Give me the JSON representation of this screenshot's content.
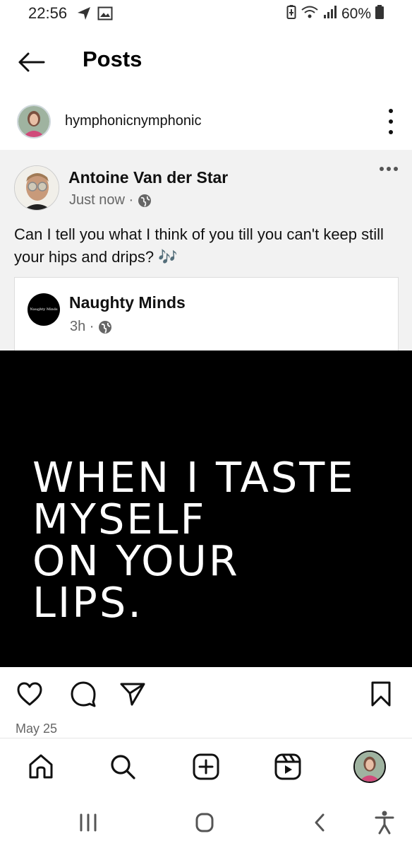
{
  "status": {
    "time": "22:56",
    "battery": "60%",
    "icons": [
      "navigation-icon",
      "gallery-icon",
      "battery-saver-icon",
      "wifi-icon",
      "signal-icon",
      "battery-icon"
    ]
  },
  "header": {
    "title": "Posts",
    "back_icon": "back-arrow-icon"
  },
  "post": {
    "username": "hymphonicnymphonic",
    "more_icon": "vertical-dots-icon",
    "embedded": {
      "author": "Antoine Van der Star",
      "time": "Just now ·",
      "text": "Can I tell you what I think of you till you can't keep still your hips and drips? 🎶",
      "shared": {
        "page_name": "Naughty Minds",
        "avatar_text": "Naughty Minds",
        "time": "3h ·"
      },
      "image_text": "WHEN I TASTE\nMYSELF\nON YOUR\nLIPS."
    },
    "date": "May 25"
  },
  "actions": [
    "like-icon",
    "comment-icon",
    "share-icon",
    "save-icon"
  ],
  "nav": [
    "home-icon",
    "search-icon",
    "create-icon",
    "reels-icon",
    "profile-icon"
  ],
  "system_nav": [
    "recents-icon",
    "home-button-icon",
    "back-icon",
    "accessibility-icon"
  ],
  "colors": {
    "background": "#ffffff",
    "card_background": "#f2f2f2",
    "image_background": "#000000",
    "muted_text": "#666666"
  }
}
